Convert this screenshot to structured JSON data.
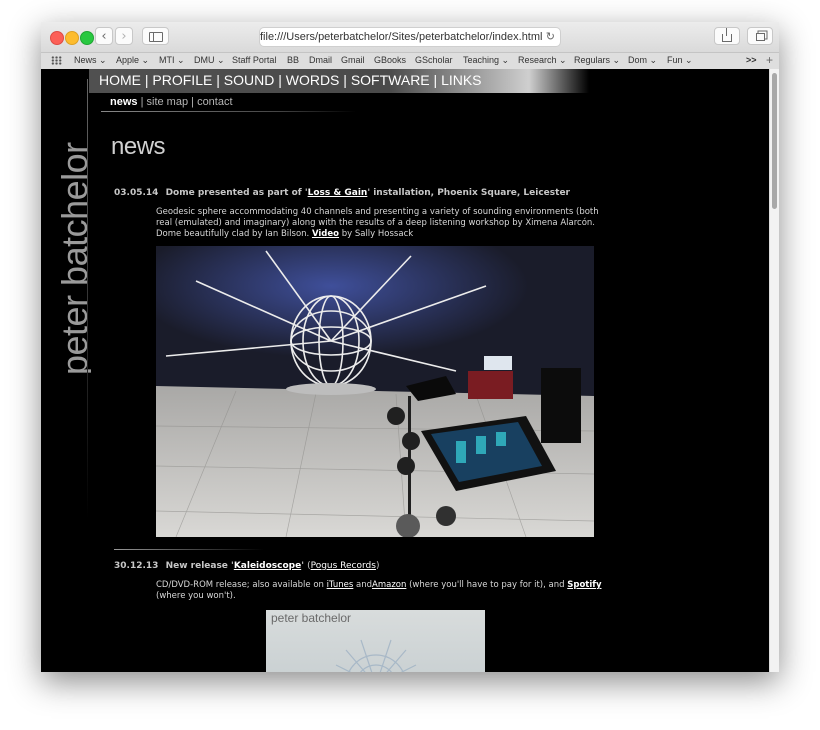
{
  "browser": {
    "url": "file:///Users/peterbatchelor/Sites/peterbatchelor/index.html",
    "bookmarks": [
      "News",
      "Apple",
      "MTI",
      "DMU",
      "Staff Portal",
      "BB",
      "Dmail",
      "Gmail",
      "GBooks",
      "GScholar",
      "Teaching",
      "Research",
      "Regulars",
      "Dom",
      "Fun"
    ],
    "overflow": ">>",
    "add_tab": "+"
  },
  "site": {
    "name": "peter batchelor",
    "nav": [
      "HOME",
      "PROFILE",
      "SOUND",
      "WORDS",
      "SOFTWARE",
      "LINKS"
    ],
    "subnav": [
      "news",
      "site map",
      "contact"
    ]
  },
  "page": {
    "heading": "news",
    "items": [
      {
        "date": "03.05.14",
        "title_pre": "Dome presented as part of '",
        "title_link": "Loss & Gain",
        "title_post": "' installation, Phoenix Square, Leicester",
        "body_pre": "Geodesic sphere accommodating 40 channels and presenting a variety of sounding environments (both real (emulated) and imaginary) along with the results of a deep listening workshop by Ximena Alarcón. Dome beautifully clad by Ian Bilson. ",
        "body_link": "Video",
        "body_post": " by Sally Hossack"
      },
      {
        "date": "30.12.13",
        "title_pre": "New release '",
        "title_link": "Kaleidoscope",
        "title_post": "' ",
        "title_paren_link": "Pogus Records",
        "body_pre": "CD/DVD-ROM release; also available on ",
        "link1": "iTunes",
        "mid1": " and",
        "link2": "Amazon",
        "mid2": " (where you'll have to pay for it), and ",
        "link3": "Spotify",
        "body_post": " (where you won't)."
      }
    ],
    "cover_title": "peter batchelor"
  }
}
